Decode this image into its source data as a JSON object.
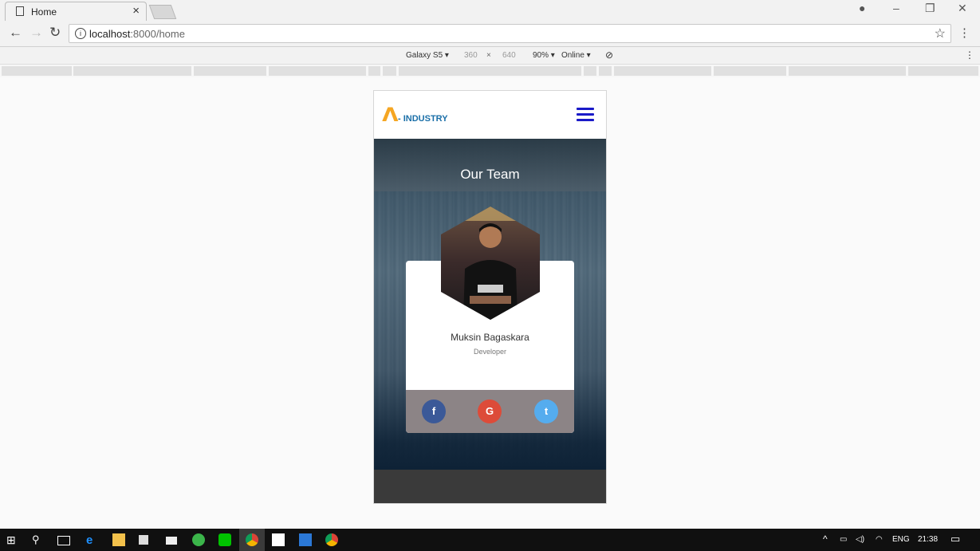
{
  "browser": {
    "tab_title": "Home",
    "url_host": "localhost",
    "url_path": ":8000/home"
  },
  "device_toolbar": {
    "device": "Galaxy S5 ▾",
    "width": "360",
    "times": "×",
    "height": "640",
    "zoom": "90% ▾",
    "network": "Online ▾"
  },
  "site": {
    "logo_mark": "Λ",
    "logo_text": "- INDUSTRY",
    "section_title": "Our Team",
    "member": {
      "name": "Muksin Bagaskara",
      "role": "Developer"
    },
    "social": {
      "facebook": "f",
      "google": "G",
      "twitter": "t"
    },
    "colors": {
      "facebook": "#3b5998",
      "google": "#dd4b39",
      "twitter": "#55acee",
      "logo_accent": "#f5a623",
      "logo_text": "#1a6fa8",
      "hamburger": "#1a1ac8"
    }
  },
  "taskbar": {
    "language": "ENG",
    "time": "21:38"
  }
}
